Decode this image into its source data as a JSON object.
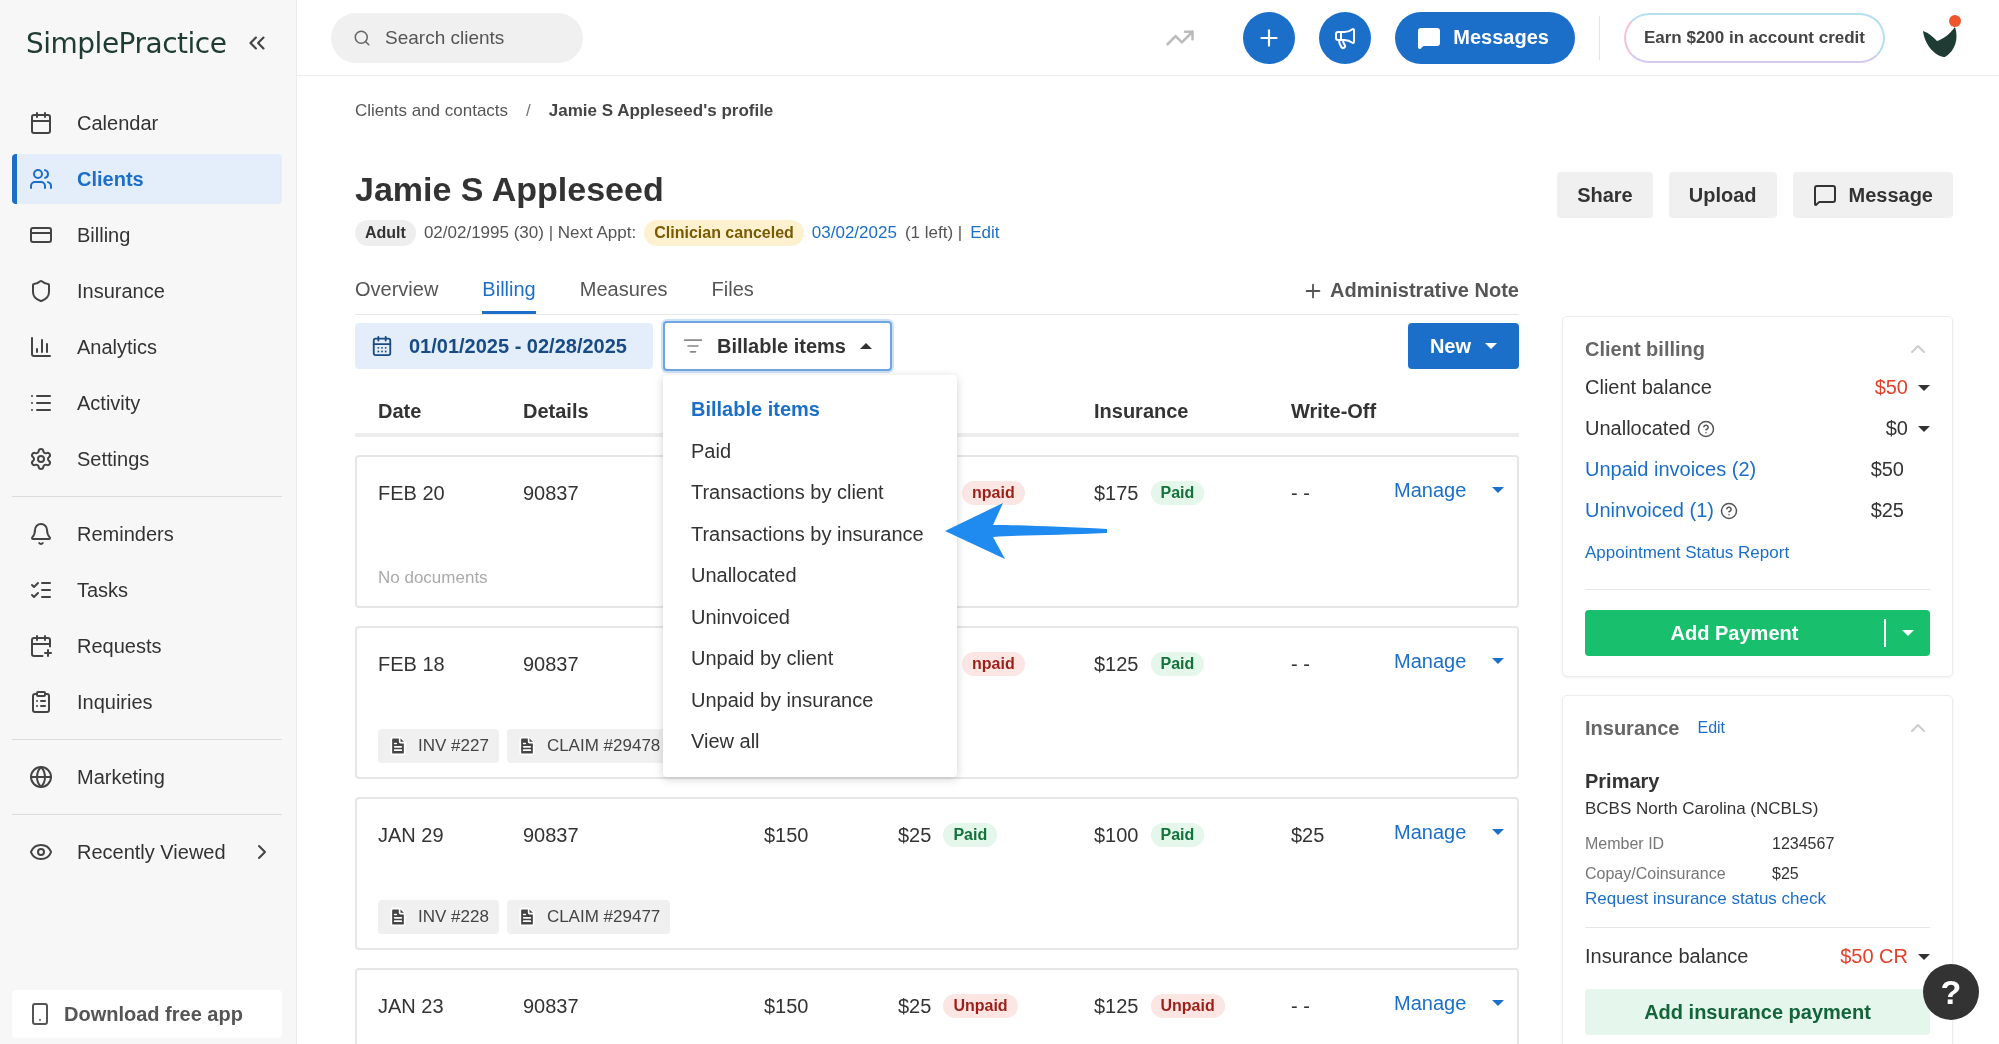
{
  "sidebar": {
    "logo": "SimplePractice",
    "nav_groups": [
      [
        {
          "label": "Calendar",
          "selected": false
        },
        {
          "label": "Clients",
          "selected": true
        },
        {
          "label": "Billing",
          "selected": false
        },
        {
          "label": "Insurance",
          "selected": false
        },
        {
          "label": "Analytics",
          "selected": false
        },
        {
          "label": "Activity",
          "selected": false
        },
        {
          "label": "Settings",
          "selected": false
        }
      ],
      [
        {
          "label": "Reminders",
          "selected": false
        },
        {
          "label": "Tasks",
          "selected": false
        },
        {
          "label": "Requests",
          "selected": false
        },
        {
          "label": "Inquiries",
          "selected": false
        }
      ],
      [
        {
          "label": "Marketing",
          "selected": false
        }
      ]
    ],
    "recently_viewed": "Recently Viewed",
    "download": "Download free app"
  },
  "topbar": {
    "search": {
      "placeholder": "Search clients"
    },
    "messages": "Messages",
    "credit": "Earn $200 in account credit"
  },
  "breadcrumb": [
    "Clients and contacts",
    "Jamie S Appleseed's profile"
  ],
  "breadcrumb_separator": "/",
  "client": {
    "name": "Jamie S Appleseed",
    "tag": "Adult",
    "birth": "02/02/1995 (30) | Next Appt:",
    "appt_status": "Clinician canceled",
    "appt_date": "03/02/2025",
    "appt_rest": "(1 left) |",
    "edit": "Edit"
  },
  "actions": [
    "Share",
    "Upload",
    "Message"
  ],
  "tabs": [
    {
      "label": "Overview",
      "selected": false
    },
    {
      "label": "Billing",
      "selected": true
    },
    {
      "label": "Measures",
      "selected": false
    },
    {
      "label": "Files",
      "selected": false
    }
  ],
  "admin_note": "Administrative Note",
  "date_range": "01/01/2025 - 02/28/2025",
  "filter": {
    "label": "Billable items",
    "expanded": true,
    "options": [
      {
        "label": "Billable items",
        "selected": true
      },
      {
        "label": "Paid",
        "selected": false
      },
      {
        "label": "Transactions by client",
        "selected": false
      },
      {
        "label": "Transactions by insurance",
        "selected": false
      },
      {
        "label": "Unallocated",
        "selected": false
      },
      {
        "label": "Uninvoiced",
        "selected": false
      },
      {
        "label": "Unpaid by client",
        "selected": false
      },
      {
        "label": "Unpaid by insurance",
        "selected": false
      },
      {
        "label": "View all",
        "selected": false
      }
    ]
  },
  "new_button": "New",
  "table": {
    "header": {
      "date": "Date",
      "details": "Details",
      "insurance": "Insurance",
      "write_off": "Write-Off"
    },
    "rows": [
      {
        "date": "FEB 20",
        "details": "90837",
        "client_status": {
          "label": "npaid",
          "paid": false
        },
        "insurance_amount": "$175",
        "insurance_status": {
          "label": "Paid",
          "paid": true
        },
        "write_off": "- -",
        "manage": "Manage",
        "no_documents": "No documents"
      },
      {
        "date": "FEB 18",
        "details": "90837",
        "client_status": {
          "label": "npaid",
          "paid": false
        },
        "insurance_amount": "$125",
        "insurance_status": {
          "label": "Paid",
          "paid": true
        },
        "write_off": "- -",
        "manage": "Manage",
        "documents": [
          "INV #227",
          "CLAIM #29478"
        ]
      },
      {
        "date": "JAN 29",
        "details": "90837",
        "fee": "$150",
        "client_amount": "$25",
        "client_status": {
          "label": "Paid",
          "paid": true
        },
        "insurance_amount": "$100",
        "insurance_status": {
          "label": "Paid",
          "paid": true
        },
        "write_off": "$25",
        "manage": "Manage",
        "documents": [
          "INV #228",
          "CLAIM #29477"
        ]
      },
      {
        "date": "JAN 23",
        "details": "90837",
        "fee": "$150",
        "client_amount": "$25",
        "client_status": {
          "label": "Unpaid",
          "paid": false
        },
        "insurance_amount": "$125",
        "insurance_status": {
          "label": "Unpaid",
          "paid": false
        },
        "write_off": "- -",
        "manage": "Manage"
      }
    ]
  },
  "client_billing": {
    "title": "Client billing",
    "lines": [
      {
        "label": "Client balance",
        "value": "$50",
        "link": false,
        "help": false,
        "dropdown": true,
        "alert": true
      },
      {
        "label": "Unallocated",
        "value": "$0",
        "link": false,
        "help": true,
        "dropdown": true,
        "alert": false
      },
      {
        "label": "Unpaid invoices (2)",
        "value": "$50",
        "link": true,
        "help": false,
        "dropdown": false,
        "alert": false
      },
      {
        "label": "Uninvoiced (1)",
        "value": "$25",
        "link": true,
        "help": true,
        "dropdown": false,
        "alert": false
      }
    ],
    "report_link": "Appointment Status Report",
    "add_payment": "Add Payment"
  },
  "insurance": {
    "title": "Insurance",
    "edit": "Edit",
    "primary": "Primary",
    "payer": "BCBS North Carolina (NCBLS)",
    "details": [
      {
        "label": "Member ID",
        "value": "1234567"
      },
      {
        "label": "Copay/Coinsurance",
        "value": "$25"
      }
    ],
    "status_link": "Request insurance status check",
    "balance": {
      "label": "Insurance balance",
      "value": "$50 CR",
      "alert": true
    },
    "add_payment": "Add insurance payment"
  },
  "help_button": "?"
}
